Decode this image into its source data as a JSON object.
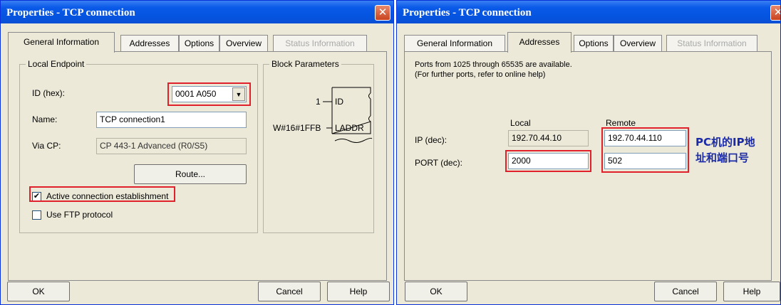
{
  "left_window": {
    "title": "Properties - TCP connection",
    "close_glyph": "✕",
    "tabs": [
      {
        "label": "General Information",
        "state": "active"
      },
      {
        "label": "Addresses",
        "state": "normal"
      },
      {
        "label": "Options",
        "state": "normal"
      },
      {
        "label": "Overview",
        "state": "normal"
      },
      {
        "label": "Status Information",
        "state": "disabled"
      }
    ],
    "local_endpoint": {
      "title": "Local Endpoint",
      "id_label": "ID (hex):",
      "id_value": "0001 A050",
      "name_label": "Name:",
      "name_value": "TCP connection1",
      "via_cp_label": "Via CP:",
      "via_cp_value": "CP 443-1 Advanced (R0/S5)",
      "route_button": "Route...",
      "active_connection_label": "Active connection establishment",
      "active_connection_checked": true,
      "ftp_label": "Use FTP protocol",
      "ftp_checked": false
    },
    "block_parameters": {
      "title": "Block Parameters",
      "id_input": "1",
      "id_pin": "ID",
      "laddr_input": "W#16#1FFB",
      "laddr_pin": "LADDR"
    },
    "buttons": {
      "ok": "OK",
      "cancel": "Cancel",
      "help": "Help"
    }
  },
  "right_window": {
    "title": "Properties - TCP connection",
    "close_glyph": "✕",
    "tabs": [
      {
        "label": "General Information",
        "state": "normal"
      },
      {
        "label": "Addresses",
        "state": "active"
      },
      {
        "label": "Options",
        "state": "normal"
      },
      {
        "label": "Overview",
        "state": "normal"
      },
      {
        "label": "Status Information",
        "state": "disabled"
      }
    ],
    "info_line1": "Ports from 1025 through 65535 are available.",
    "info_line2": "(For further ports, refer to online help)",
    "col_local": "Local",
    "col_remote": "Remote",
    "ip_label": "IP (dec):",
    "port_label": "PORT (dec):",
    "local_ip": "192.70.44.10",
    "local_port": "2000",
    "remote_ip": "192.70.44.110",
    "remote_port": "502",
    "annotation_line1": "PC机的IP地",
    "annotation_line2": "址和端口号",
    "buttons": {
      "ok": "OK",
      "cancel": "Cancel",
      "help": "Help"
    }
  }
}
